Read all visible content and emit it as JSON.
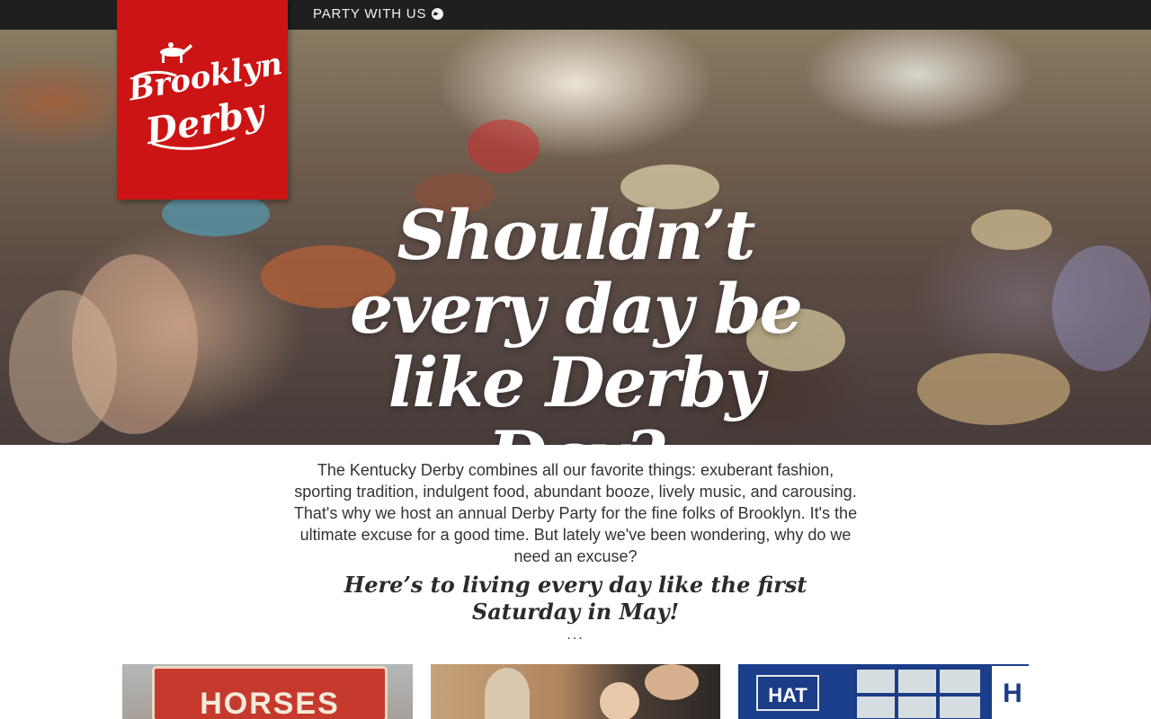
{
  "nav": {
    "party_link": "PARTY WITH US"
  },
  "logo": {
    "line1": "Brooklyn",
    "line2": "Derby",
    "icon": "horse-rider-icon",
    "color": "#cc1414"
  },
  "hero": {
    "headline": "Shouldn’t every day be like Derby Day?"
  },
  "intro": {
    "paragraph": "The Kentucky Derby combines all our favorite things: exuberant fashion, sporting tradition, indulgent food, abundant booze, lively music, and carousing. That's why we host an annual Derby Party for the fine folks of Brooklyn. It's the ultimate excuse for a good time. But lately we've been wondering, why do we need an excuse?",
    "tagline": "Here’s to living every day like the first Saturday in May!",
    "separator": "..."
  },
  "gallery": [
    {
      "sign_text": "HORSES"
    },
    {
      "sign_text": ""
    },
    {
      "sign_text": "HAT",
      "side_sign": "H"
    }
  ]
}
